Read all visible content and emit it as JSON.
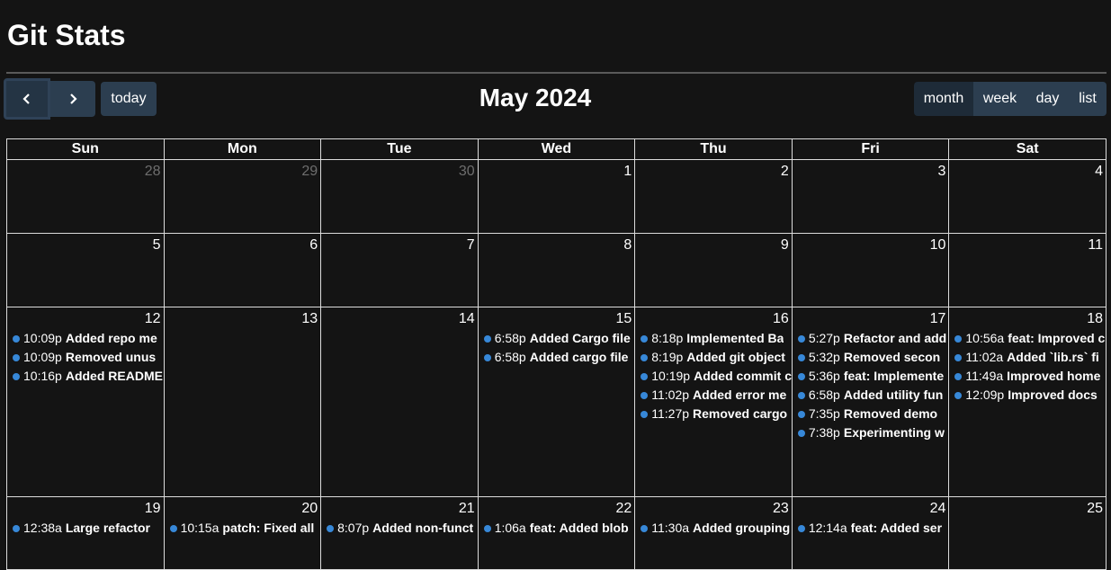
{
  "app": {
    "title": "Git Stats"
  },
  "toolbar": {
    "title": "May 2024",
    "today_label": "today",
    "views": [
      "month",
      "week",
      "day",
      "list"
    ],
    "active_view": "month"
  },
  "calendar": {
    "weekdays": [
      "Sun",
      "Mon",
      "Tue",
      "Wed",
      "Thu",
      "Fri",
      "Sat"
    ],
    "weeks": [
      [
        {
          "day": "28",
          "other": true,
          "events": []
        },
        {
          "day": "29",
          "other": true,
          "events": []
        },
        {
          "day": "30",
          "other": true,
          "events": []
        },
        {
          "day": "1",
          "events": []
        },
        {
          "day": "2",
          "events": []
        },
        {
          "day": "3",
          "events": []
        },
        {
          "day": "4",
          "events": []
        }
      ],
      [
        {
          "day": "5",
          "events": []
        },
        {
          "day": "6",
          "events": []
        },
        {
          "day": "7",
          "events": []
        },
        {
          "day": "8",
          "events": []
        },
        {
          "day": "9",
          "events": []
        },
        {
          "day": "10",
          "events": []
        },
        {
          "day": "11",
          "events": []
        }
      ],
      [
        {
          "day": "12",
          "events": [
            {
              "time": "10:09p",
              "title": "Added repo me"
            },
            {
              "time": "10:09p",
              "title": "Removed unus"
            },
            {
              "time": "10:16p",
              "title": "Added README"
            }
          ]
        },
        {
          "day": "13",
          "events": []
        },
        {
          "day": "14",
          "events": []
        },
        {
          "day": "15",
          "events": [
            {
              "time": "6:58p",
              "title": "Added Cargo file"
            },
            {
              "time": "6:58p",
              "title": "Added cargo file"
            }
          ]
        },
        {
          "day": "16",
          "events": [
            {
              "time": "8:18p",
              "title": "Implemented Ba"
            },
            {
              "time": "8:19p",
              "title": "Added git object"
            },
            {
              "time": "10:19p",
              "title": "Added commit c"
            },
            {
              "time": "11:02p",
              "title": "Added error me"
            },
            {
              "time": "11:27p",
              "title": "Removed cargo"
            }
          ]
        },
        {
          "day": "17",
          "events": [
            {
              "time": "5:27p",
              "title": "Refactor and add"
            },
            {
              "time": "5:32p",
              "title": "Removed secon"
            },
            {
              "time": "5:36p",
              "title": "feat: Implemente"
            },
            {
              "time": "6:58p",
              "title": "Added utility fun"
            },
            {
              "time": "7:35p",
              "title": "Removed demo"
            },
            {
              "time": "7:38p",
              "title": "Experimenting w"
            }
          ]
        },
        {
          "day": "18",
          "events": [
            {
              "time": "10:56a",
              "title": "feat: Improved c"
            },
            {
              "time": "11:02a",
              "title": "Added `lib.rs` fi"
            },
            {
              "time": "11:49a",
              "title": "Improved home"
            },
            {
              "time": "12:09p",
              "title": "Improved docs"
            }
          ]
        }
      ],
      [
        {
          "day": "19",
          "events": [
            {
              "time": "12:38a",
              "title": "Large refactor"
            }
          ]
        },
        {
          "day": "20",
          "events": [
            {
              "time": "10:15a",
              "title": "patch: Fixed all"
            }
          ]
        },
        {
          "day": "21",
          "events": [
            {
              "time": "8:07p",
              "title": "Added non-funct"
            }
          ]
        },
        {
          "day": "22",
          "events": [
            {
              "time": "1:06a",
              "title": "feat: Added blob"
            }
          ]
        },
        {
          "day": "23",
          "events": [
            {
              "time": "11:30a",
              "title": "Added grouping"
            }
          ]
        },
        {
          "day": "24",
          "events": [
            {
              "time": "12:14a",
              "title": "feat: Added ser"
            }
          ]
        },
        {
          "day": "25",
          "events": []
        }
      ]
    ]
  },
  "colors": {
    "background": "#141414",
    "button": "#2c3e50",
    "button_active": "#1e2b38",
    "event_dot": "#3788d8",
    "grid_line": "#dcdcdc"
  },
  "icons": {
    "prev": "chevron-left-icon",
    "next": "chevron-right-icon"
  }
}
